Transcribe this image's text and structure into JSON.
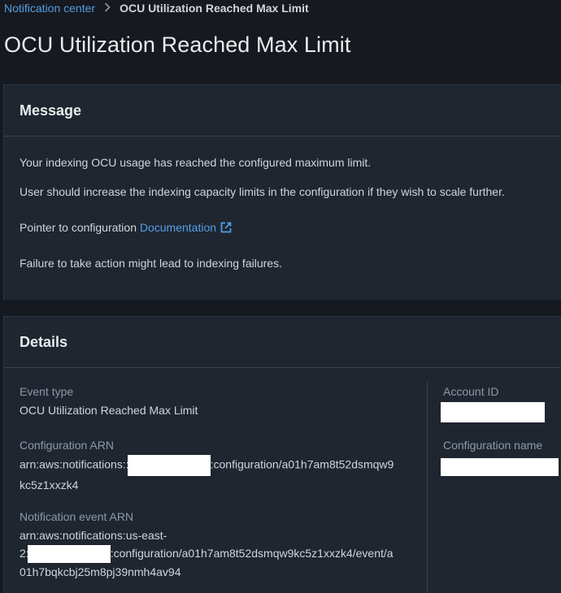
{
  "breadcrumb": {
    "parent": "Notification center",
    "current": "OCU Utilization Reached Max Limit"
  },
  "page_title": "OCU Utilization Reached Max Limit",
  "message": {
    "heading": "Message",
    "line1": "Your indexing OCU usage has reached the configured maximum limit.",
    "line2": "User should increase the indexing capacity limits in the configuration if they wish to scale further.",
    "pointer_prefix": "Pointer to configuration ",
    "doc_link": "Documentation",
    "line4": "Failure to take action might lead to indexing failures."
  },
  "details": {
    "heading": "Details",
    "event_type_label": "Event type",
    "event_type_value": "OCU Utilization Reached Max Limit",
    "config_arn_label": "Configuration ARN",
    "config_arn_prefix": "arn:aws:notifications::",
    "config_arn_suffix": ":configuration/a01h7am8t52dsmqw9",
    "config_arn_line2": "kc5z1xxzk4",
    "event_arn_label": "Notification event ARN",
    "event_arn_line1": "arn:aws:notifications:us-east-",
    "event_arn_line2_prefix": "2:",
    "event_arn_line2_suffix": ":configuration/a01h7am8t52dsmqw9kc5z1xxzk4/event/a",
    "event_arn_line3": "01h7bqkcbj25m8pj39nmh4av94",
    "account_id_label": "Account ID",
    "config_name_label": "Configuration name"
  },
  "colors": {
    "link": "#539fe5",
    "background": "#16191f",
    "panel": "#1f2630",
    "redaction": "#ffffff"
  }
}
